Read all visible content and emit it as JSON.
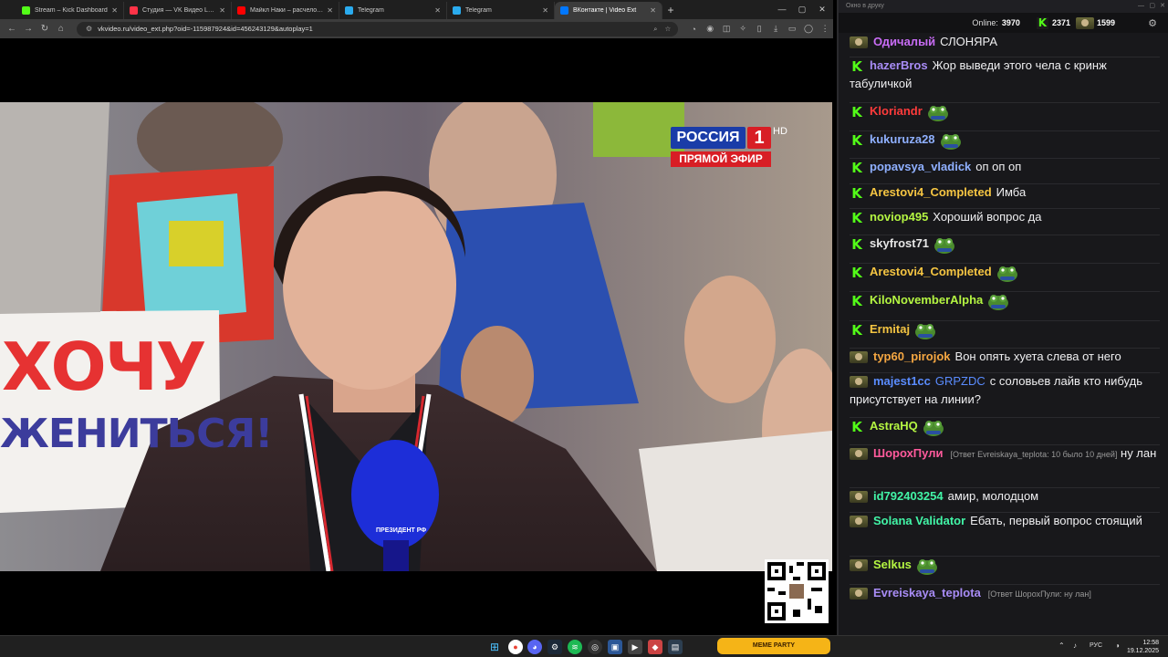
{
  "browser": {
    "tabs": [
      {
        "label": "Stream – Kick Dashboard",
        "icon": "kick-icon",
        "color": "#53fc18"
      },
      {
        "label": "Студия — VK Видео Live",
        "icon": "vk-video-icon",
        "color": "#ff3347"
      },
      {
        "label": "Майкл Наки – расчеловечиваю",
        "icon": "youtube-icon",
        "color": "#ff0000"
      },
      {
        "label": "Telegram",
        "icon": "telegram-icon",
        "color": "#2aabee"
      },
      {
        "label": "Telegram",
        "icon": "telegram-icon",
        "color": "#2aabee"
      },
      {
        "label": "ВКонтакте | Video Ext",
        "icon": "vk-icon",
        "color": "#0077ff"
      }
    ],
    "url": "vkvideo.ru/video_ext.php?oid=-115987924&id=456243129&autoplay=1"
  },
  "video": {
    "channel_logo": "РОССИЯ",
    "channel_number": "1",
    "hd": "HD",
    "live_label": "ПРЯМОЙ ЭФИР",
    "sign_line1": "ХОЧУ",
    "sign_line2": "ЖЕНИТЬСЯ!",
    "mic_label": "ПРЕЗИДЕНТ РФ"
  },
  "chat": {
    "window_title": "Окно в друку",
    "online_label": "Online:",
    "online_count": "3970",
    "kick_count": "2371",
    "vk_count": "1599",
    "messages": [
      {
        "badge": "avatar",
        "user": "Одичалый",
        "color": "#c86cf5",
        "text": "СЛОНЯРА"
      },
      {
        "badge": "kick",
        "user": "hazerBros",
        "color": "#a88cf5",
        "text": "Жор выведи этого чела с кринж табуличкой"
      },
      {
        "badge": "kick",
        "user": "Kloriandr",
        "color": "#ff3b3b",
        "text": "",
        "emote": true
      },
      {
        "badge": "kick",
        "user": "kukuruza28",
        "color": "#8fb0ff",
        "text": "",
        "emote": true
      },
      {
        "badge": "kick",
        "user": "popavsya_vladick",
        "color": "#8fb0ff",
        "text": "оп оп оп"
      },
      {
        "badge": "kick",
        "user": "Arestovi4_Completed",
        "color": "#f5c542",
        "text": "Имба"
      },
      {
        "badge": "kick",
        "user": "noviop495",
        "color": "#b4f542",
        "text": "Хороший вопрос да"
      },
      {
        "badge": "kick",
        "user": "skyfrost71",
        "color": "#e6e6e6",
        "text": "",
        "emote": true
      },
      {
        "badge": "kick",
        "user": "Arestovi4_Completed",
        "color": "#f5c542",
        "text": "",
        "emote": true
      },
      {
        "badge": "kick",
        "user": "KiloNovemberAlpha",
        "color": "#b4f542",
        "text": "",
        "emote": true
      },
      {
        "badge": "kick",
        "user": "Ermitaj",
        "color": "#f5c542",
        "text": "",
        "emote": true
      },
      {
        "badge": "avatar",
        "user": "typ60_pirojok",
        "color": "#f5a742",
        "text": "Вон опять хуета слева от него"
      },
      {
        "badge": "avatar",
        "user": "majest1cc",
        "mention": "GRPZDC",
        "color": "#5a8cff",
        "text": "с соловьев лайв кто нибудь присутствует на линии?"
      },
      {
        "badge": "kick",
        "user": "AstraHQ",
        "color": "#b4f542",
        "text": "",
        "emote": true
      },
      {
        "badge": "avatar",
        "user": "ШорохПули",
        "color": "#ff5a9c",
        "reply": "[Ответ Evreiskaya_teplota: 10 было 10 дней]",
        "text": "ну лан"
      },
      {
        "badge": "avatar",
        "user": "id792403254",
        "color": "#42f5a7",
        "text": "амир, молодцом"
      },
      {
        "badge": "avatar",
        "user": "Solana Validator",
        "color": "#42f5a7",
        "text": "Ебать, первый вопрос стоящий"
      },
      {
        "badge": "avatar",
        "user": "Selkus",
        "color": "#b4f542",
        "text": "",
        "emote": true
      },
      {
        "badge": "avatar",
        "user": "Evreiskaya_teplota",
        "color": "#a88cf5",
        "reply": "[Ответ ШорохПули: ну лан]",
        "text": ""
      }
    ]
  },
  "taskbar": {
    "lang": "РУС",
    "time": "12:58",
    "date": "19.12.2025",
    "widget": "MEME PARTY"
  }
}
